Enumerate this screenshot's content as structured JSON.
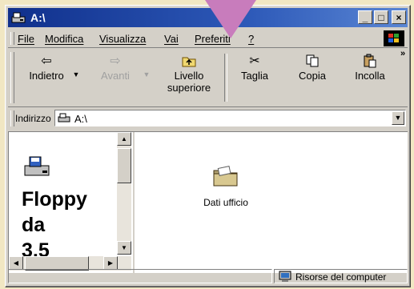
{
  "window": {
    "title": "A:\\"
  },
  "titlebar_buttons": {
    "minimize": "_",
    "maximize": "□",
    "close": "×"
  },
  "menu": [
    "File",
    "Modifica",
    "Visualizza",
    "Vai",
    "Preferiti",
    "?"
  ],
  "toolbar": {
    "back": "Indietro",
    "forward": "Avanti",
    "up_line1": "Livello",
    "up_line2": "superiore",
    "cut": "Taglia",
    "copy": "Copia",
    "paste": "Incolla",
    "more": "»"
  },
  "address": {
    "label": "Indirizzo",
    "value": "A:\\"
  },
  "left_pane": {
    "title_lines": [
      "Floppy",
      "da",
      "3,5"
    ]
  },
  "folder": {
    "name": "Dati ufficio"
  },
  "status": {
    "zone": "Risorse del computer"
  },
  "colors": {
    "titlebar": "#10308c",
    "window": "#d4d0c8",
    "pointer": "#c87cbc",
    "background": "#f1e7c3"
  }
}
